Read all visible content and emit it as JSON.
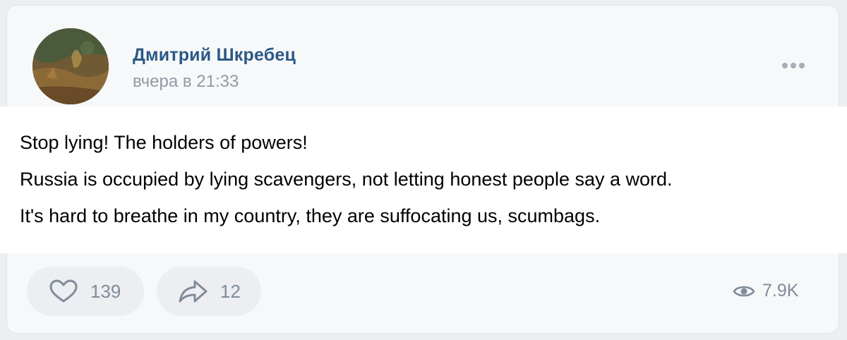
{
  "post": {
    "author": "Дмитрий Шкребец",
    "time": "вчера в 21:33",
    "text_lines": [
      "Stop lying! The holders of powers!",
      "Russia is occupied by lying scavengers, not letting honest people say a word.",
      "It's hard to breathe in my country, they are suffocating us, scumbags."
    ]
  },
  "actions": {
    "likes": "139",
    "shares": "12",
    "views": "7.9K"
  },
  "icons": {
    "like": "heart-icon",
    "share": "share-arrow-icon",
    "views": "eye-icon",
    "more": "more-dots-icon"
  },
  "colors": {
    "author": "#2a5885",
    "muted": "#939aa3",
    "button_bg": "#eceef1",
    "icon": "#818c99"
  }
}
